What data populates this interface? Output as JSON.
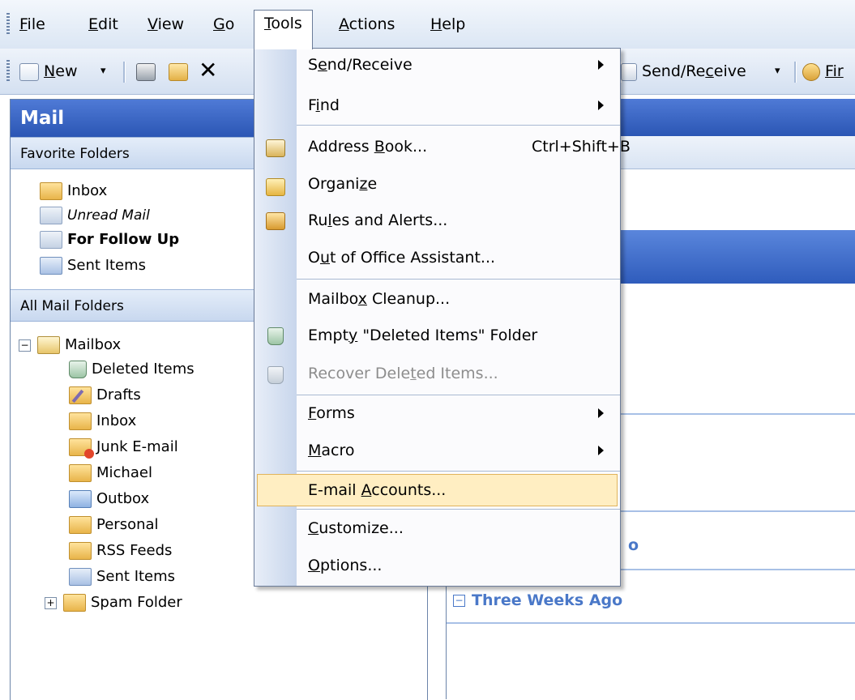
{
  "menu_bar": {
    "items": [
      {
        "label": "File",
        "accel": "F",
        "rest": "ile"
      },
      {
        "label": "Edit",
        "accel": "E",
        "rest": "dit"
      },
      {
        "label": "View",
        "accel": "V",
        "rest": "iew"
      },
      {
        "label": "Go",
        "accel": "G",
        "rest": "o"
      },
      {
        "label": "Tools",
        "accel": "T",
        "rest": "ools"
      },
      {
        "label": "Actions",
        "accel": "A",
        "rest": "ctions"
      },
      {
        "label": "Help",
        "accel": "H",
        "rest": "elp"
      }
    ]
  },
  "toolbar": {
    "new_label": "New",
    "new_accel": "N",
    "new_rest": "ew",
    "send_receive_pre": "Send/Re",
    "send_receive_accel": "c",
    "send_receive_post": "eive",
    "find_label": "Fir"
  },
  "left_pane": {
    "title": "Mail",
    "favorites_header": "Favorite Folders",
    "favorites": [
      "Inbox",
      "Unread Mail",
      "For Follow Up",
      "Sent Items"
    ],
    "all_header": "All Mail Folders",
    "mailbox_label": "Mailbox",
    "folders": [
      "Deleted Items",
      "Drafts",
      "Inbox",
      "Junk E-mail",
      "Michael",
      "Outbox",
      "Personal",
      "RSS Feeds",
      "Sent Items",
      "Spam Folder"
    ]
  },
  "right_pane": {
    "group_partial": "o",
    "group_three_weeks": "Three Weeks Ago"
  },
  "tools_menu": {
    "send_receive": {
      "pre": "S",
      "accel": "e",
      "post": "nd/Receive"
    },
    "find": {
      "pre": "F",
      "accel": "i",
      "post": "nd"
    },
    "address_book": {
      "pre": "Address ",
      "accel": "B",
      "post": "ook...",
      "shortcut": "Ctrl+Shift+B"
    },
    "organize": {
      "pre": "Organi",
      "accel": "z",
      "post": "e"
    },
    "rules": {
      "pre": "Ru",
      "accel": "l",
      "post": "es and Alerts..."
    },
    "out_of_office": {
      "pre": "O",
      "accel": "u",
      "post": "t of Office Assistant..."
    },
    "mailbox_cleanup": {
      "pre": "Mailbo",
      "accel": "x",
      "post": " Cleanup..."
    },
    "empty_deleted": {
      "pre": "Empt",
      "accel": "y",
      "post": " \"Deleted Items\" Folder"
    },
    "recover_deleted": {
      "pre": "Recover Dele",
      "accel": "t",
      "post": "ed Items..."
    },
    "forms": {
      "pre": "",
      "accel": "F",
      "post": "orms"
    },
    "macro": {
      "pre": "",
      "accel": "M",
      "post": "acro"
    },
    "email_accounts": {
      "pre": "E-mail ",
      "accel": "A",
      "post": "ccounts..."
    },
    "customize": {
      "pre": "",
      "accel": "C",
      "post": "ustomize..."
    },
    "options": {
      "pre": "",
      "accel": "O",
      "post": "ptions..."
    }
  },
  "colors": {
    "header_blue": "#2b56b4",
    "menu_highlight": "#ffeec2",
    "group_text": "#4a78c8"
  }
}
